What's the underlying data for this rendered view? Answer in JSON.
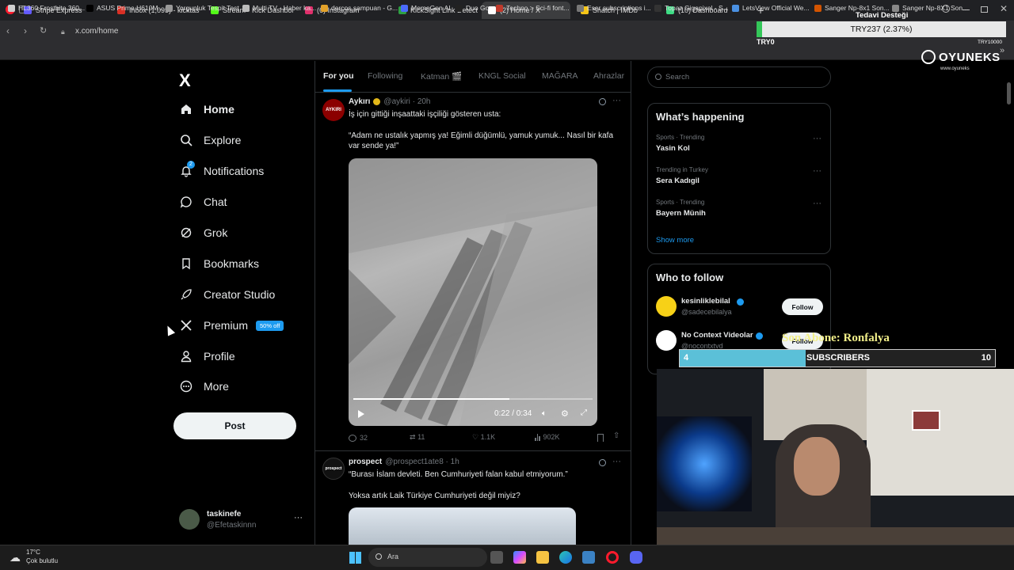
{
  "browser": {
    "tabs": [
      {
        "label": "Stripe Express",
        "color": "#635bff"
      },
      {
        "label": "Inbox (1,095) - kicktasking",
        "color": "#d93025"
      },
      {
        "label": "Stream - Kick Dashboard",
        "color": "#53fc18"
      },
      {
        "label": "(6) Instagram",
        "color": "#e1306c"
      },
      {
        "label": "KickSight Link Detector",
        "color": "#2ea043"
      },
      {
        "label": "(2) Home / X",
        "color": "#ffffff"
      },
      {
        "label": "Snatch | IMDb",
        "color": "#f5c518"
      },
      {
        "label": "(10) Dashboard",
        "color": "#3ddc84"
      }
    ],
    "url": "x.com/home",
    "bookmarks": [
      "HL360 Frostbite 360...",
      "ASUS Prime H610M...",
      "Yorgunluk Tespit Test",
      "Multi TV - Haber ka...",
      "dercos şampuan - G...",
      "MemeGen AI",
      "Duo Go",
      "Techno > Sci-fi font...",
      "Eser subscriptions i...",
      "Topaz Gigapixel - S...",
      "LetsView Official We...",
      "Sanger Np-8x1 Son...",
      "Sanger Np-8X1 Son..."
    ]
  },
  "sidebar": {
    "logo": "X",
    "items": [
      {
        "label": "Home",
        "icon": "home-icon"
      },
      {
        "label": "Explore",
        "icon": "search-icon"
      },
      {
        "label": "Notifications",
        "icon": "bell-icon",
        "badge": "2"
      },
      {
        "label": "Chat",
        "icon": "chat-icon"
      },
      {
        "label": "Grok",
        "icon": "grok-icon"
      },
      {
        "label": "Bookmarks",
        "icon": "bookmark-icon"
      },
      {
        "label": "Creator Studio",
        "icon": "rocket-icon"
      },
      {
        "label": "Premium",
        "icon": "x-icon",
        "badge": "50% off"
      },
      {
        "label": "Profile",
        "icon": "person-icon"
      },
      {
        "label": "More",
        "icon": "more-circle-icon"
      }
    ],
    "post_label": "Post",
    "account": {
      "name": "taskinefe",
      "handle": "@Efetaskinnn"
    }
  },
  "feed": {
    "tabs": [
      "For you",
      "Following",
      "Katman 🎬",
      "KNGL Social",
      "MAĞARA",
      "Ahrazlar"
    ],
    "tweets": [
      {
        "name": "Aykırı",
        "handle": "@aykiri",
        "time": "20h",
        "avatar_text": "AYKIRI",
        "text1": "İş için gittiği inşaattaki işçiliği gösteren usta:",
        "text2": "“Adam ne ustalık yapmış ya! Eğimli düğümlü, yamuk yumuk... Nasıl bir kafa var sende ya!”",
        "video_time": "0:22 / 0:34",
        "replies": "32",
        "reposts": "11",
        "likes": "1.1K",
        "views": "902K"
      },
      {
        "name": "prospect",
        "handle": "@prospect1ate8",
        "time": "1h",
        "avatar_text": "prospect",
        "text1": "“Burası İslam devleti. Ben Cumhuriyeti falan kabul etmiyorum.”",
        "text2": "Yoksa artık Laik Türkiye Cumhuriyeti değil miyiz?"
      }
    ]
  },
  "right": {
    "search_placeholder": "Search",
    "happening_title": "What’s happening",
    "trends": [
      {
        "meta": "Sports · Trending",
        "name": "Yasin Kol"
      },
      {
        "meta": "Trending in Turkey",
        "name": "Sera Kadıgil"
      },
      {
        "meta": "Sports · Trending",
        "name": "Bayern Münih"
      }
    ],
    "show_more": "Show more",
    "follow_title": "Who to follow",
    "follow": [
      {
        "name": "kesinliklebilal",
        "handle": "@sadecebilalya",
        "button": "Follow"
      },
      {
        "name": "No Context Videolar",
        "handle": "@nocontxtvd",
        "button": "Follow"
      }
    ]
  },
  "overlay": {
    "donation_title": "Tedavi Desteği",
    "donation_amount": "TRY237 (2.37%)",
    "donation_min": "TRY0",
    "donation_max": "TRY10000",
    "donation_fraction": 0.0237,
    "brand": "OYUNEKS",
    "brand_sub": "www.oyuneks",
    "last_sub": "Son Abone: Ronfalya",
    "sub_current": "4",
    "sub_label": "SUBSCRIBERS",
    "sub_goal": "10"
  },
  "taskbar": {
    "temp": "17°C",
    "weather": "Çok bulutlu",
    "search": "Ara"
  }
}
